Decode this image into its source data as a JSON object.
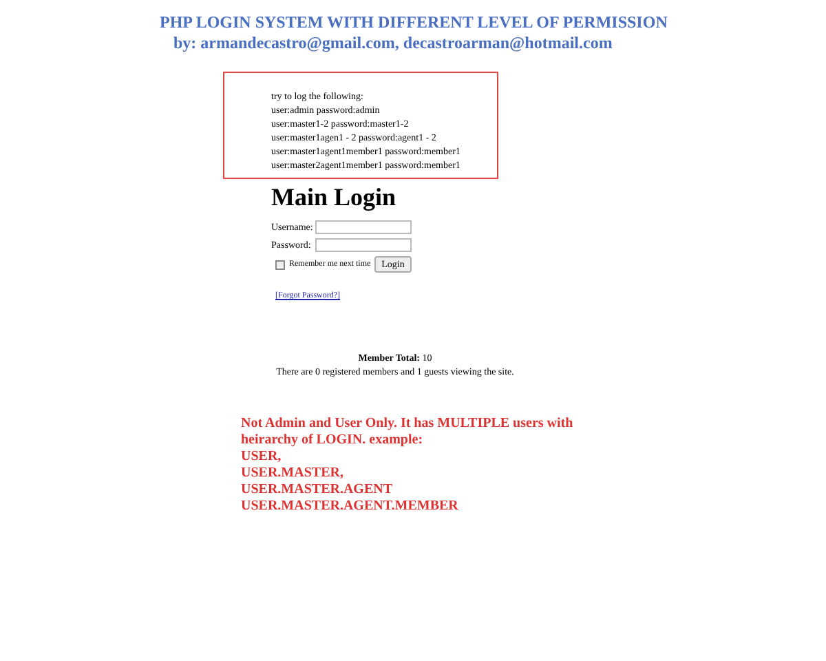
{
  "header": {
    "title": "PHP LOGIN SYSTEM WITH DIFFERENT LEVEL OF PERMISSION",
    "byline": "by: armandecastro@gmail.com, decastroarman@hotmail.com"
  },
  "hint_box": {
    "lines": [
      "try to log the following:",
      "user:admin password:admin",
      "user:master1-2 password:master1-2",
      "user:master1agen1 - 2 password:agent1 - 2",
      "user:master1agent1member1 password:member1",
      "user:master2agent1member1 password:member1"
    ]
  },
  "login": {
    "title": "Main Login",
    "username_label": "Username:",
    "password_label": "Password:",
    "remember": {
      "label": "Remember me next time",
      "checked": false
    },
    "button": "Login",
    "forgot_link": "[Forgot Password?]"
  },
  "stats": {
    "total": "**Member Total:** 10",
    "online": "There are 0 registered members and 1 guests viewing the site."
  },
  "note": {
    "lines": [
      "Not Admin and User Only. It has MULTIPLE users with heirarchy of LOGIN. example:",
      "USER,",
      "USER.MASTER,",
      "USER.MASTER.AGENT",
      "USER.MASTER.AGENT.MEMBER"
    ]
  }
}
